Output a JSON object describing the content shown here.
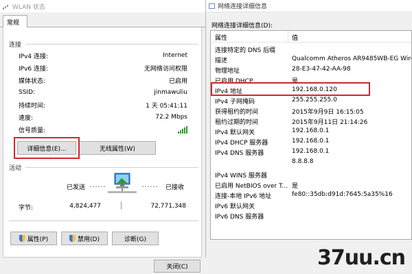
{
  "left": {
    "title": "WLAN 状态",
    "tab": "常规",
    "connection_label": "连接",
    "rows": [
      {
        "label": "IPv4 连接:",
        "value": "Internet"
      },
      {
        "label": "IPv6 连接:",
        "value": "无网络访问权限"
      },
      {
        "label": "媒体状态:",
        "value": "已启用"
      },
      {
        "label": "SSID:",
        "value": "jinmawuliu"
      },
      {
        "label": "持续时间:",
        "value": "1 天 05:41:11"
      },
      {
        "label": "速度:",
        "value": "72.2 Mbps"
      }
    ],
    "signal_label": "信号质量:",
    "details_button": "详细信息(E)...",
    "wireless_button": "无线属性(W)",
    "activity_label": "活动",
    "sent_label": "已发送",
    "received_label": "已接收",
    "bytes_label": "字节:",
    "bytes_sent": "4,824,477",
    "bytes_received": "72,771,348",
    "properties_button": "属性(P)",
    "disable_button": "禁用(D)",
    "diagnose_button": "诊断(G)",
    "close_button": "关闭(C)"
  },
  "right": {
    "title": "网络连接详细信息",
    "caption": "网络连接详细信息(D):",
    "col_property": "属性",
    "col_value": "值",
    "rows": [
      {
        "k": "连接特定的 DNS 后缀",
        "v": ""
      },
      {
        "k": "描述",
        "v": "Qualcomm Atheros AR9485WB-EG Wire"
      },
      {
        "k": "物理地址",
        "v": "28-E3-47-42-AA-98"
      },
      {
        "k": "已启用 DHCP",
        "v": "是"
      },
      {
        "k": "IPv4 地址",
        "v": "192.168.0.120"
      },
      {
        "k": "IPv4 子网掩码",
        "v": "255.255.255.0"
      },
      {
        "k": "获得租约的时间",
        "v": "2015年9月9日 16:15:05"
      },
      {
        "k": "租约过期的时间",
        "v": "2015年9月11日 21:14:26"
      },
      {
        "k": "IPv4 默认网关",
        "v": "192.168.0.1"
      },
      {
        "k": "IPv4 DHCP 服务器",
        "v": "192.168.0.1"
      },
      {
        "k": "IPv4 DNS 服务器",
        "v": "192.168.0.1"
      },
      {
        "k": "",
        "v": "8.8.8.8"
      },
      {
        "k": "IPv4 WINS 服务器",
        "v": ""
      },
      {
        "k": "已启用 NetBIOS over T...",
        "v": "是"
      },
      {
        "k": "连接-本地 IPv6 地址",
        "v": "fe80::35db:d91d:7645:5a35%16"
      },
      {
        "k": "IPv6 默认网关",
        "v": ""
      },
      {
        "k": "IPv6 DNS 服务器",
        "v": ""
      }
    ],
    "watermark": "37uu.cn"
  },
  "colors": {
    "highlight": "#d0262e",
    "signal": "#2e9a2e"
  }
}
